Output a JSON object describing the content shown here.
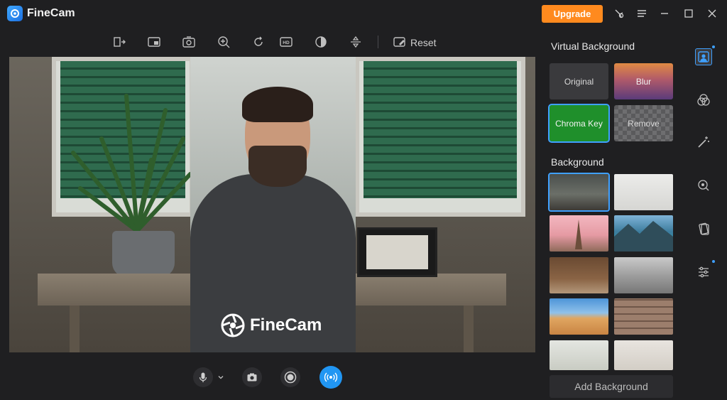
{
  "app": {
    "title": "FineCam"
  },
  "titlebar": {
    "upgrade_label": "Upgrade",
    "icons": [
      "pin-icon",
      "menu-icon",
      "minimize-icon",
      "maximize-icon",
      "close-icon"
    ]
  },
  "toolbar": {
    "icons": [
      "mirror-icon",
      "pip-icon",
      "camera-switch-icon",
      "zoom-in-icon",
      "rotate-icon",
      "hd-icon",
      "contrast-icon",
      "flip-icon",
      "reset-icon"
    ],
    "reset_label": "Reset"
  },
  "preview": {
    "watermark": "FineCam"
  },
  "controls": {
    "icons": [
      "microphone-icon",
      "chevron-down-icon",
      "snapshot-icon",
      "record-icon",
      "broadcast-icon"
    ]
  },
  "virtual_background": {
    "title": "Virtual Background",
    "options": [
      "Original",
      "Blur",
      "Chroma Key",
      "Remove"
    ]
  },
  "background": {
    "title": "Background",
    "thumbnails": [
      "office-desk",
      "plain-white",
      "eiffel-tower",
      "mountain-lake",
      "library",
      "white-loft",
      "desert",
      "brick-wall",
      "plant-room",
      "gallery-wall"
    ],
    "add_label": "Add Background"
  },
  "sidebar": {
    "icons": [
      "portrait-icon",
      "filters-icon",
      "magic-wand-icon",
      "ai-face-icon",
      "layers-icon",
      "adjust-sliders-icon"
    ]
  },
  "colors": {
    "accent": "#3fa0ff",
    "upgrade": "#ff8a1e",
    "chroma": "#1f8f2b"
  }
}
